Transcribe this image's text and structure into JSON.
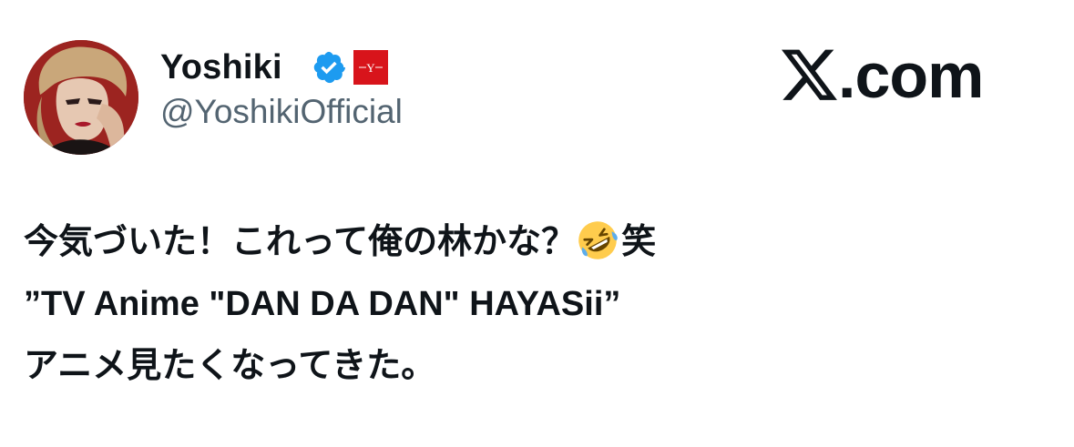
{
  "author": {
    "display_name": "Yoshiki",
    "handle": "@YoshikiOfficial",
    "avatar_icon": "profile-photo",
    "verified_icon": "verified-badge-icon",
    "affiliate_icon": "affiliate-badge-icon",
    "affiliate_badge_text": "Y"
  },
  "site": {
    "logo_icon": "x-logo-icon",
    "logo_text": ".com"
  },
  "tweet": {
    "line1_before_emoji": "今気づいた！これって俺の林かな？",
    "line1_emoji": "rolling-on-the-floor-laughing",
    "line1_after_emoji": "笑",
    "line2": "”TV Anime \"DAN DA DAN\" HAYASii”",
    "line3": "アニメ見たくなってきた。"
  },
  "colors": {
    "text_primary": "#0f1419",
    "text_secondary": "#536471",
    "verified_blue": "#1d9bf0",
    "affiliate_red": "#d8141b"
  }
}
